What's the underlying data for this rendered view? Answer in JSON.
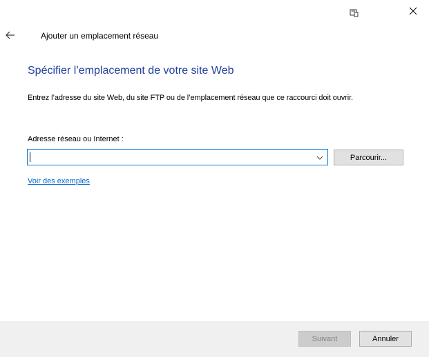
{
  "window": {
    "wizard_title": "Ajouter un emplacement réseau"
  },
  "page": {
    "heading": "Spécifier l’emplacement de votre site Web",
    "description": "Entrez l’adresse du site Web, du site FTP ou de l’emplacement réseau que ce raccourci doit ouvrir.",
    "field_label": "Adresse réseau ou Internet :",
    "address_value": "",
    "browse_label": "Parcourir...",
    "examples_link": "Voir des exemples"
  },
  "footer": {
    "next_label": "Suivant",
    "cancel_label": "Annuler"
  },
  "colors": {
    "heading": "#1f3f9a",
    "link": "#0066cc",
    "focus_border": "#0078d7",
    "footer_bg": "#f0f0f0"
  },
  "icons": {
    "titlebar": "window-tablet-icon",
    "close": "close-icon",
    "back": "back-arrow-icon",
    "dropdown": "chevron-down-icon"
  }
}
